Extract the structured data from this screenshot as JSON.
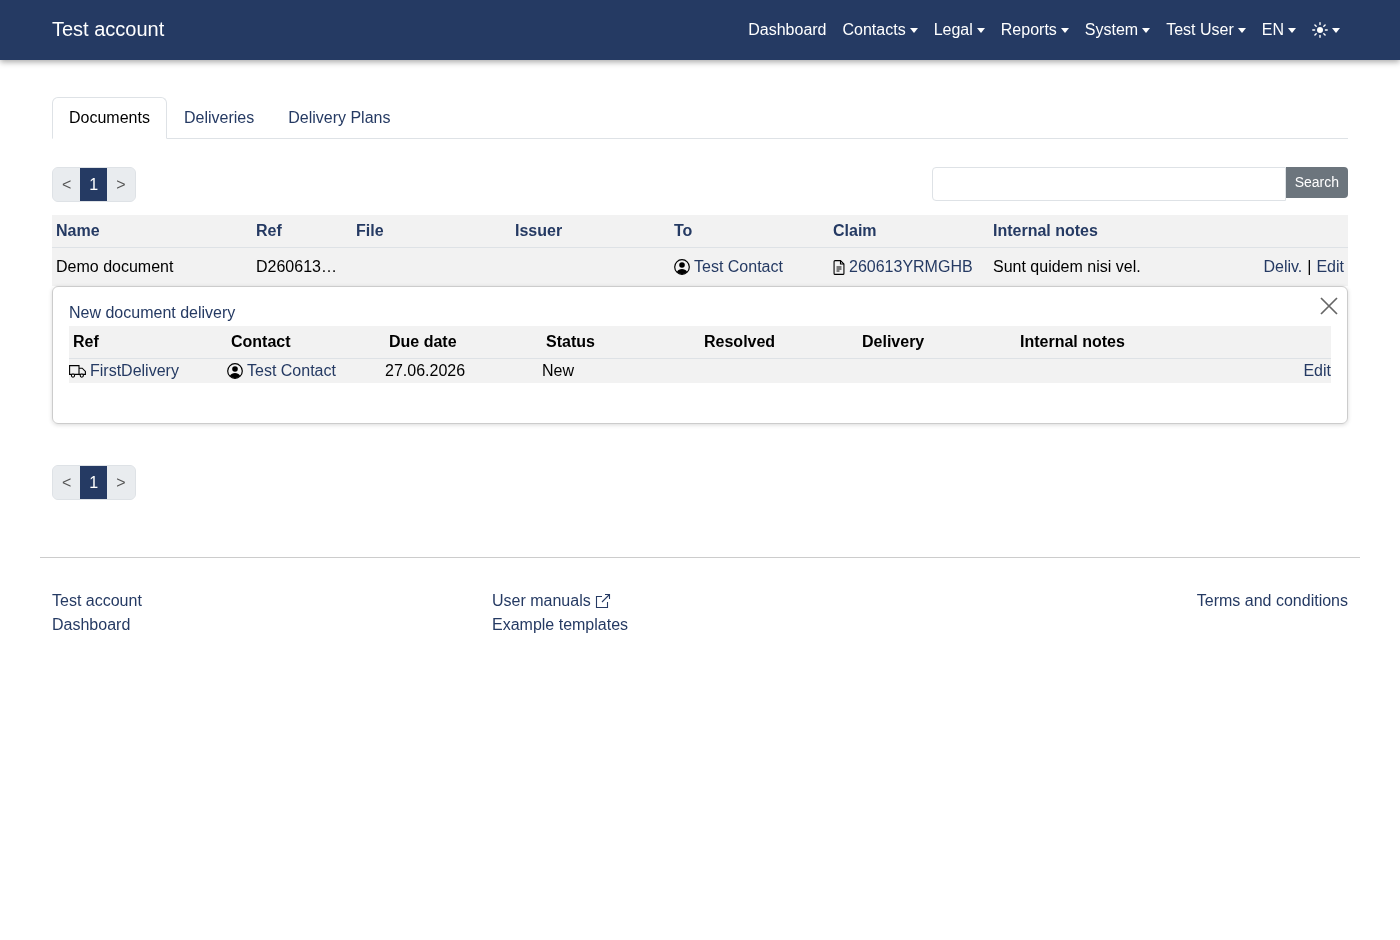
{
  "navbar": {
    "brand": "Test account",
    "items": [
      {
        "kind": "link",
        "label": "Dashboard",
        "dropdown": false
      },
      {
        "kind": "link",
        "label": "Contacts",
        "dropdown": true
      },
      {
        "kind": "link",
        "label": "Legal",
        "dropdown": true
      },
      {
        "kind": "link",
        "label": "Reports",
        "dropdown": true
      },
      {
        "kind": "link",
        "label": "System",
        "dropdown": true
      },
      {
        "kind": "link",
        "label": "Test User",
        "dropdown": true
      },
      {
        "kind": "link",
        "label": "EN",
        "dropdown": true
      },
      {
        "kind": "theme",
        "dropdown": true
      }
    ]
  },
  "tabs": [
    {
      "label": "Documents",
      "selected": true
    },
    {
      "label": "Deliveries",
      "selected": false
    },
    {
      "label": "Delivery Plans",
      "selected": false
    }
  ],
  "pagination_top": {
    "previous": "<",
    "pages": [
      {
        "label": "1",
        "selected": true
      }
    ],
    "next": ">"
  },
  "search": {
    "button": "Search"
  },
  "documents_table": {
    "columns": [
      "Name",
      "Ref",
      "File",
      "Issuer",
      "To",
      "Claim",
      "Internal notes"
    ],
    "rows": [
      {
        "name": "Demo document",
        "ref": "D260613…",
        "to": "Test Contact",
        "claim": "260613YRMGHB",
        "internal_notes": "Sunt quidem nisi vel.",
        "actions": [
          "Deliv.",
          "Edit"
        ],
        "action_separator": "|",
        "delivery_panel": {
          "title": "New document delivery",
          "columns": [
            "Ref",
            "Contact",
            "Due date",
            "Status",
            "Resolved",
            "Delivery",
            "Internal notes"
          ],
          "rows": [
            {
              "ref": "FirstDelivery",
              "contact": "Test Contact",
              "due_date": "27.06.2026",
              "status": "New",
              "actions": [
                "Edit"
              ]
            }
          ]
        }
      }
    ]
  },
  "pagination_bottom": {
    "previous": "<",
    "pages": [
      {
        "label": "1",
        "selected": true
      }
    ],
    "next": ">"
  },
  "footer": {
    "columns": [
      {
        "links": [
          {
            "label": "Test account",
            "external": false
          },
          {
            "label": "Dashboard",
            "external": false
          }
        ]
      },
      {
        "links": [
          {
            "label": "User manuals",
            "external": true
          },
          {
            "label": "Example templates",
            "external": false
          }
        ]
      },
      {
        "links": [
          {
            "label": "Terms and conditions",
            "external": false
          }
        ]
      }
    ]
  }
}
